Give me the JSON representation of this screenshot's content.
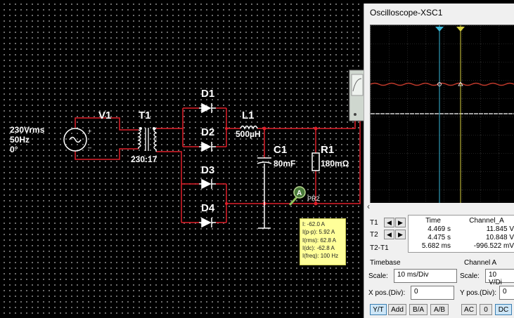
{
  "circuit": {
    "source": {
      "ref": "V1",
      "line1": "230Vrms",
      "line2": "50Hz",
      "line3": "0°"
    },
    "transformer": {
      "ref": "T1",
      "ratio": "230:17"
    },
    "diodes": [
      "D1",
      "D2",
      "D3",
      "D4"
    ],
    "inductor": {
      "ref": "L1",
      "value": "500µH"
    },
    "capacitor": {
      "ref": "C1",
      "value": "80mF"
    },
    "resistor": {
      "ref": "R1",
      "value": "180mΩ"
    },
    "probe": {
      "name": "PR2",
      "glyph": "A",
      "readings": [
        "I: -62.0 A",
        "I(p-p): 5.92 A",
        "I(rms): 62.8 A",
        "I(dc): -62.8 A",
        "I(freq): 100 Hz"
      ]
    }
  },
  "oscilloscope": {
    "title": "Oscilloscope-XSC1",
    "scroll_left": "‹",
    "cursor_left_symbol": "◀",
    "cursor_right_symbol": "▶",
    "t1_label": "T1",
    "t2_label": "T2",
    "t2t1_label": "T2-T1",
    "headers": {
      "time": "Time",
      "channel_a": "Channel_A"
    },
    "rows": [
      {
        "time": "4.469 s",
        "channel_a": "11.845 V"
      },
      {
        "time": "4.475 s",
        "channel_a": "10.848 V"
      },
      {
        "time": "5.682 ms",
        "channel_a": "-996.522 mV"
      }
    ],
    "timebase": {
      "group_label": "Timebase",
      "scale_label": "Scale:",
      "scale_value": "10 ms/Div",
      "xpos_label": "X pos.(Div):",
      "xpos_value": "0",
      "buttons": [
        "Y/T",
        "Add",
        "B/A",
        "A/B"
      ],
      "active_button": "Y/T"
    },
    "channel_a": {
      "group_label": "Channel A",
      "scale_label": "Scale:",
      "scale_value": "10  V/Di",
      "ypos_label": "Y pos.(Div):",
      "ypos_value": "0",
      "buttons": [
        "AC",
        "0",
        "DC"
      ],
      "active_button": "DC"
    },
    "colors": {
      "trace_a": "#c0392b",
      "trace_b": "#ffffff",
      "cursor1": "#38b8d8",
      "cursor2": "#d8d040"
    }
  },
  "colors": {
    "wire": "#e0202a",
    "component": "#ffffff",
    "source_wire": "#e0202a"
  }
}
